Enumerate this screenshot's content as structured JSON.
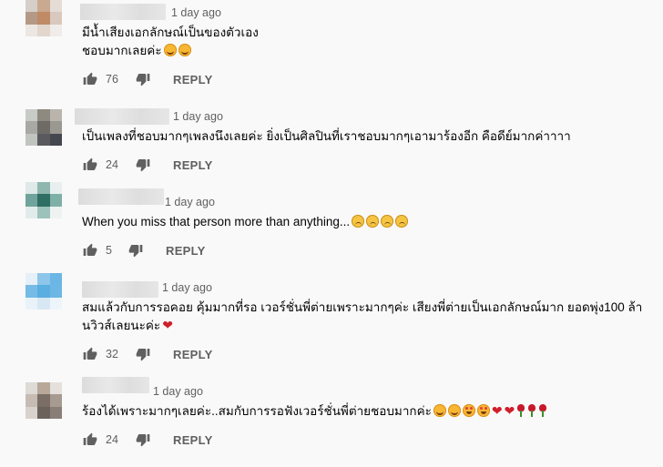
{
  "comments": [
    {
      "time": "1 day ago",
      "lines": [
        "มีน้ำเสียงเอกลักษณ์เป็นของตัวเอง",
        "ชอบมากเลยค่ะ"
      ],
      "likes": "76",
      "reply_label": "REPLY"
    },
    {
      "time": "1 day ago",
      "lines": [
        "เป็นเพลงที่ชอบมากๆเพลงนึงเลยค่ะ ยิ่งเป็นศิลปินที่เราชอบมากๆเอามาร้องอีก คือดีย์มากค่าาาา"
      ],
      "likes": "24",
      "reply_label": "REPLY"
    },
    {
      "time": "1 day ago",
      "lines": [
        "When you miss that person more than anything..."
      ],
      "likes": "5",
      "reply_label": "REPLY"
    },
    {
      "time": "1 day ago",
      "lines": [
        "สมแล้วกับการรอคอย คุ้มมากที่รอ เวอร์ชั่นพี่ต่ายเพราะมากๆค่ะ เสียงพี่ต่ายเป็นเอกลักษณ์มาก ยอดพุ่ง100 ล้า",
        "นวิวส์เลยนะค่ะ"
      ],
      "likes": "32",
      "reply_label": "REPLY"
    },
    {
      "time": "1 day ago",
      "lines": [
        "ร้องได้เพราะมากๆเลยค่ะ..สมกับการรอฟังเวอร์ชั่นพี่ต่ายชอบมากค่ะ"
      ],
      "likes": "24",
      "reply_label": "REPLY"
    }
  ],
  "icons": {
    "like": "thumb-up-icon",
    "dislike": "thumb-down-icon"
  },
  "colors": {
    "background": "#f9f9f9",
    "text": "#030303",
    "secondary_text": "#606060",
    "heart": "#d01f2b"
  }
}
